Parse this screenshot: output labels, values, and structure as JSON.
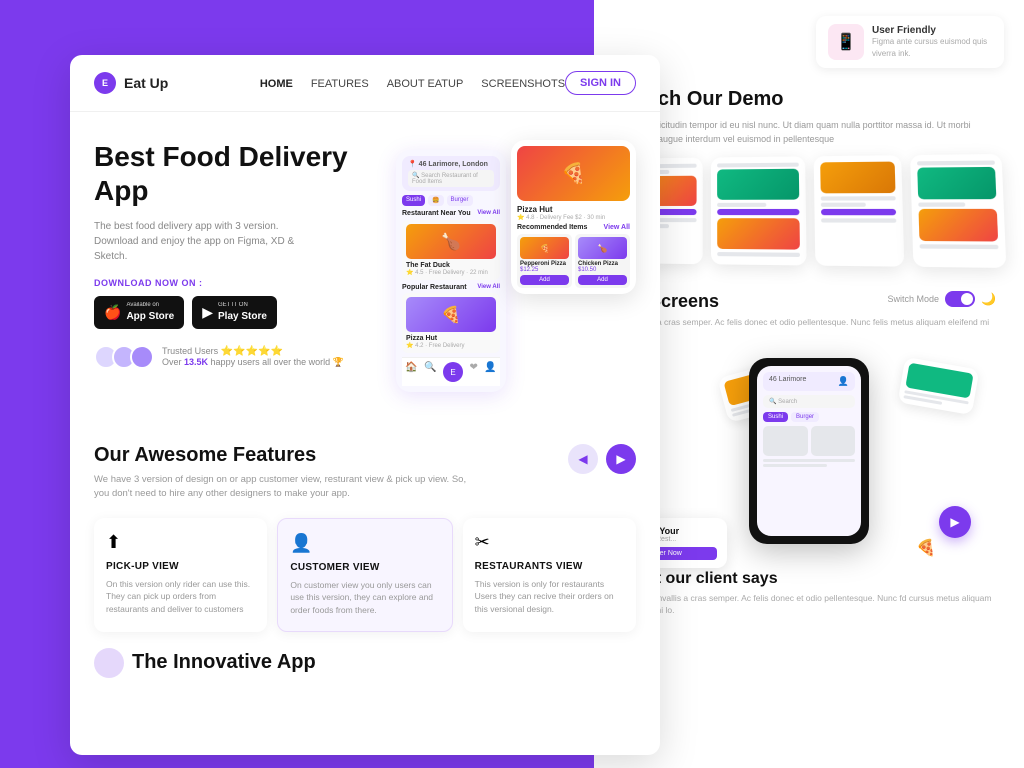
{
  "brand": {
    "name": "Eat Up",
    "logo_letter": "E"
  },
  "navbar": {
    "links": [
      {
        "label": "HOME",
        "active": true
      },
      {
        "label": "FEATURES",
        "active": false
      },
      {
        "label": "ABOUT EATUP",
        "active": false
      },
      {
        "label": "SCREENSHOTS",
        "active": false
      }
    ],
    "signin": "SIGN IN"
  },
  "hero": {
    "title": "Best Food Delivery App",
    "description": "The best food delivery app with 3 version. Download and enjoy the app on Figma, XD & Sketch.",
    "download_label": "DOWNLOAD NOW ON :",
    "app_store": "App Store",
    "play_store": "Play Store",
    "available_on": "Available on",
    "get_it_on": "GET IT ON",
    "trusted_label": "Trusted Users",
    "trusted_count": "13.5K",
    "trusted_desc": "Over 13.5K happy users all over the world 🏆"
  },
  "features": {
    "title": "Our Awesome Features",
    "description": "We have 3 version of design on or app customer view, resturant view & pick up view. So, you don't need to hire any other designers to make your app.",
    "cards": [
      {
        "icon": "⬆",
        "title": "PICK-UP VIEW",
        "description": "On this version only rider can use this. They can pick up orders from restaurants and deliver to customers",
        "highlight": false
      },
      {
        "icon": "👤",
        "title": "CUSTOMER VIEW",
        "description": "On customer view you only users can use this version, they can explore and order foods from there.",
        "highlight": true
      },
      {
        "icon": "✂",
        "title": "RESTAURANTS VIEW",
        "description": "This version is only for restaurants Users they can recive their orders on this versional design.",
        "highlight": false
      }
    ]
  },
  "bottom_hero": {
    "text": "The Innovative App"
  },
  "right_panel": {
    "user_friendly": {
      "title": "User Friendly",
      "description": "Figma ante cursus euismod quis viverra ink."
    },
    "watch_demo": {
      "title": "Watch Our Demo",
      "description": "Diam sollicitudin tempor id eu nisl nunc. Ut diam quam nulla porttitor massa id. Ut morbi tincidunt augue interdum vel euismod in pellentesque"
    },
    "app_screens": {
      "title": "pp Screens",
      "description": "convallis a cras semper. Ac felis donec et odio pellentesque. Nunc felis metus aliquam eleifend mi lo.",
      "switch_label": "Switch Mode"
    },
    "get_your": {
      "title": "Get Your",
      "subtitle": "Any Rest...",
      "btn": "Order Now"
    },
    "client_says": {
      "title": "What our client says",
      "description": "Veque convallis a cras semper. Ac felis donec et odio pellentesque. Nunc fd cursus metus aliquam eleifend mi lo."
    }
  },
  "phone_mockup": {
    "location": "46 Larimore, London",
    "search_placeholder": "Search Restaurant of Food Items",
    "tags": [
      "Sushi",
      "Burger"
    ],
    "nearby_title": "Restaurant Near You",
    "popular_title": "Popular Restaurant",
    "restaurant_name": "The Fat Duck",
    "restaurant_price": "Pizza Hut",
    "recommended_title": "Recommended Items",
    "view_all": "View All",
    "items": [
      {
        "name": "Pepperoni Pizza",
        "price": "$12.25",
        "emoji": "🍕"
      },
      {
        "name": "Chicken Pizza",
        "price": "$10.50",
        "emoji": "🍗"
      }
    ]
  }
}
